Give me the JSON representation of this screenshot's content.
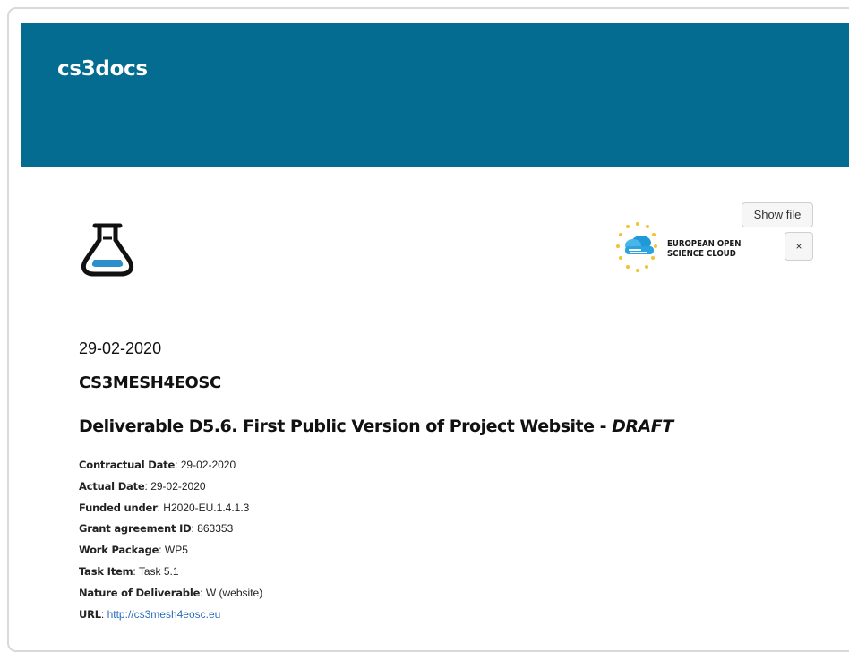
{
  "header": {
    "brand": "cs3docs",
    "bg_color": "#046b91"
  },
  "actions": {
    "show_file_label": "Show file",
    "close_label": "×"
  },
  "logos": {
    "left_icon": "flask-icon",
    "eosc_line1": "EUROPEAN OPEN",
    "eosc_line2": "SCIENCE CLOUD"
  },
  "doc": {
    "date": "29-02-2020",
    "project": "CS3MESH4EOSC",
    "title_main": "Deliverable D5.6. First Public Version of Project Website - ",
    "title_flag": "DRAFT",
    "meta": [
      {
        "label": "Contractual Date",
        "value": "29-02-2020"
      },
      {
        "label": "Actual Date",
        "value": "29-02-2020"
      },
      {
        "label": "Funded under",
        "value": "H2020-EU.1.4.1.3"
      },
      {
        "label": "Grant agreement ID",
        "value": "863353"
      },
      {
        "label": "Work Package",
        "value": "WP5"
      },
      {
        "label": "Task Item",
        "value": "Task 5.1"
      },
      {
        "label": "Nature of Deliverable",
        "value": "W (website)"
      },
      {
        "label": "URL",
        "value": "http://cs3mesh4eosc.eu"
      }
    ]
  }
}
